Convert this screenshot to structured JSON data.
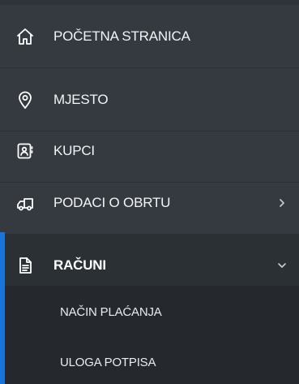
{
  "sidebar": {
    "items": [
      {
        "label": "POČETNA STRANICA",
        "icon": "home-icon"
      },
      {
        "label": "MJESTO",
        "icon": "location-pin-icon"
      },
      {
        "label": "KUPCI",
        "icon": "contacts-book-icon"
      },
      {
        "label": "PODACI O OBRTU",
        "icon": "truck-icon",
        "has_submenu": true,
        "expanded": false
      },
      {
        "label": "RAČUNI",
        "icon": "document-icon",
        "has_submenu": true,
        "expanded": true,
        "active": true
      }
    ],
    "submenu": [
      {
        "label": "NAČIN PLAĆANJA"
      },
      {
        "label": "ULOGA POTPISA"
      }
    ]
  },
  "colors": {
    "background": "#343a40",
    "active_background": "#2b3035",
    "submenu_background": "#25292e",
    "accent": "#1a73d9",
    "text": "#f2f4f6"
  }
}
